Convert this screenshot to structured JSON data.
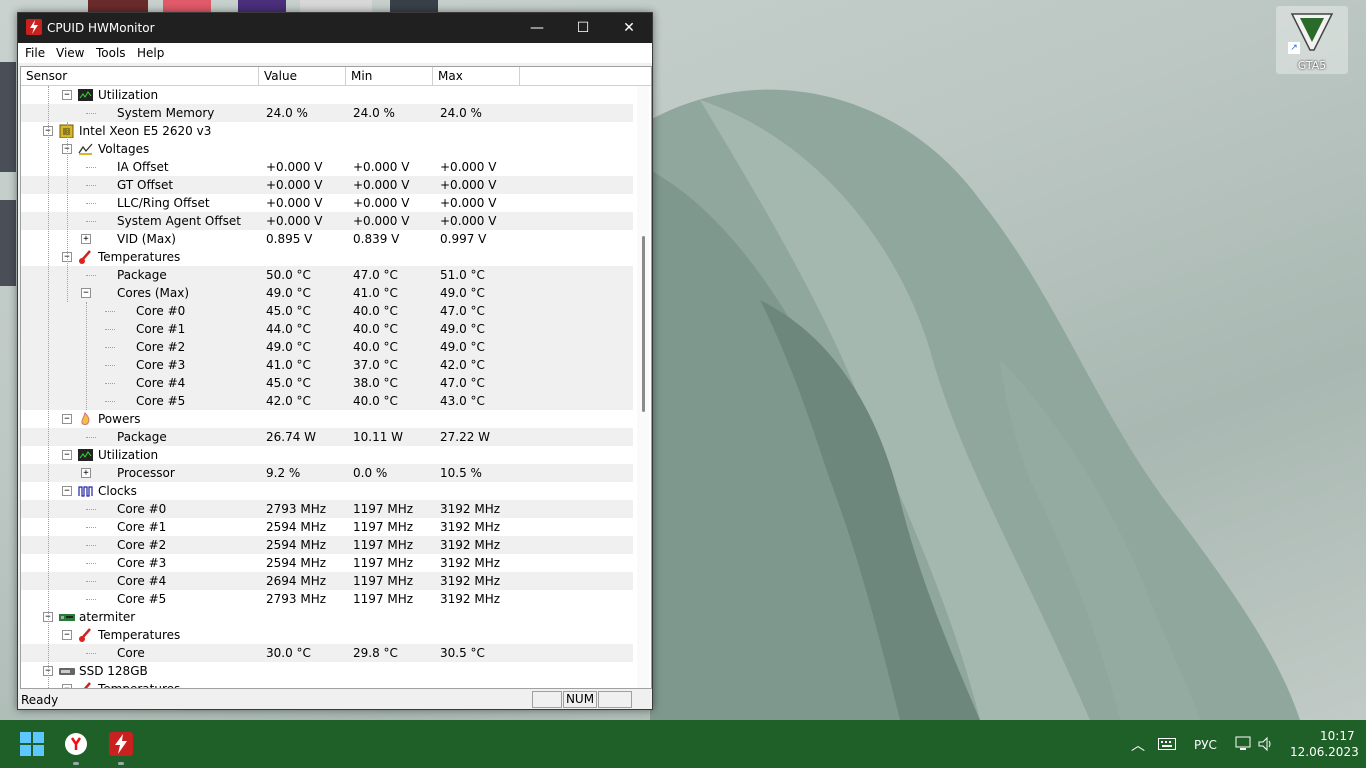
{
  "window": {
    "title": "CPUID HWMonitor",
    "controls": {
      "minimize": "—",
      "maximize": "☐",
      "close": "✕"
    }
  },
  "menu": [
    "File",
    "View",
    "Tools",
    "Help"
  ],
  "columns": [
    "Sensor",
    "Value",
    "Min",
    "Max"
  ],
  "rows": [
    {
      "label": "Utilization",
      "level": 1,
      "box": "−",
      "icon": "utilization-icon",
      "value": "",
      "min": "",
      "max": ""
    },
    {
      "label": "System Memory",
      "level": 2,
      "box": "",
      "icon": "",
      "value": "24.0 %",
      "min": "24.0 %",
      "max": "24.0 %"
    },
    {
      "label": "Intel Xeon E5 2620 v3",
      "level": 0,
      "box": "−",
      "icon": "cpu-chip-icon",
      "value": "",
      "min": "",
      "max": ""
    },
    {
      "label": "Voltages",
      "level": 1,
      "box": "−",
      "icon": "voltage-icon",
      "value": "",
      "min": "",
      "max": ""
    },
    {
      "label": "IA Offset",
      "level": 2,
      "box": "",
      "icon": "",
      "value": "+0.000 V",
      "min": "+0.000 V",
      "max": "+0.000 V"
    },
    {
      "label": "GT Offset",
      "level": 2,
      "box": "",
      "icon": "",
      "value": "+0.000 V",
      "min": "+0.000 V",
      "max": "+0.000 V"
    },
    {
      "label": "LLC/Ring Offset",
      "level": 2,
      "box": "",
      "icon": "",
      "value": "+0.000 V",
      "min": "+0.000 V",
      "max": "+0.000 V"
    },
    {
      "label": "System Agent Offset",
      "level": 2,
      "box": "",
      "icon": "",
      "value": "+0.000 V",
      "min": "+0.000 V",
      "max": "+0.000 V"
    },
    {
      "label": "VID (Max)",
      "level": 2,
      "box": "+",
      "icon": "",
      "value": "0.895 V",
      "min": "0.839 V",
      "max": "0.997 V"
    },
    {
      "label": "Temperatures",
      "level": 1,
      "box": "−",
      "icon": "thermometer-icon",
      "value": "",
      "min": "",
      "max": ""
    },
    {
      "label": "Package",
      "level": 2,
      "box": "",
      "icon": "",
      "value": "50.0 °C",
      "min": "47.0 °C",
      "max": "51.0 °C"
    },
    {
      "label": "Cores (Max)",
      "level": 2,
      "box": "−",
      "icon": "",
      "value": "49.0 °C",
      "min": "41.0 °C",
      "max": "49.0 °C"
    },
    {
      "label": "Core #0",
      "level": 3,
      "box": "",
      "icon": "",
      "value": "45.0 °C",
      "min": "40.0 °C",
      "max": "47.0 °C"
    },
    {
      "label": "Core #1",
      "level": 3,
      "box": "",
      "icon": "",
      "value": "44.0 °C",
      "min": "40.0 °C",
      "max": "49.0 °C"
    },
    {
      "label": "Core #2",
      "level": 3,
      "box": "",
      "icon": "",
      "value": "49.0 °C",
      "min": "40.0 °C",
      "max": "49.0 °C"
    },
    {
      "label": "Core #3",
      "level": 3,
      "box": "",
      "icon": "",
      "value": "41.0 °C",
      "min": "37.0 °C",
      "max": "42.0 °C"
    },
    {
      "label": "Core #4",
      "level": 3,
      "box": "",
      "icon": "",
      "value": "45.0 °C",
      "min": "38.0 °C",
      "max": "47.0 °C"
    },
    {
      "label": "Core #5",
      "level": 3,
      "box": "",
      "icon": "",
      "value": "42.0 °C",
      "min": "40.0 °C",
      "max": "43.0 °C"
    },
    {
      "label": "Powers",
      "level": 1,
      "box": "−",
      "icon": "power-flame-icon",
      "value": "",
      "min": "",
      "max": ""
    },
    {
      "label": "Package",
      "level": 2,
      "box": "",
      "icon": "",
      "value": "26.74 W",
      "min": "10.11 W",
      "max": "27.22 W"
    },
    {
      "label": "Utilization",
      "level": 1,
      "box": "−",
      "icon": "utilization-icon",
      "value": "",
      "min": "",
      "max": ""
    },
    {
      "label": "Processor",
      "level": 2,
      "box": "+",
      "icon": "",
      "value": "9.2 %",
      "min": "0.0 %",
      "max": "10.5 %"
    },
    {
      "label": "Clocks",
      "level": 1,
      "box": "−",
      "icon": "clock-wave-icon",
      "value": "",
      "min": "",
      "max": ""
    },
    {
      "label": "Core #0",
      "level": 2,
      "box": "",
      "icon": "",
      "value": "2793 MHz",
      "min": "1197 MHz",
      "max": "3192 MHz"
    },
    {
      "label": "Core #1",
      "level": 2,
      "box": "",
      "icon": "",
      "value": "2594 MHz",
      "min": "1197 MHz",
      "max": "3192 MHz"
    },
    {
      "label": "Core #2",
      "level": 2,
      "box": "",
      "icon": "",
      "value": "2594 MHz",
      "min": "1197 MHz",
      "max": "3192 MHz"
    },
    {
      "label": "Core #3",
      "level": 2,
      "box": "",
      "icon": "",
      "value": "2594 MHz",
      "min": "1197 MHz",
      "max": "3192 MHz"
    },
    {
      "label": "Core #4",
      "level": 2,
      "box": "",
      "icon": "",
      "value": "2694 MHz",
      "min": "1197 MHz",
      "max": "3192 MHz"
    },
    {
      "label": "Core #5",
      "level": 2,
      "box": "",
      "icon": "",
      "value": "2793 MHz",
      "min": "1197 MHz",
      "max": "3192 MHz"
    },
    {
      "label": "atermiter",
      "level": 0,
      "box": "−",
      "icon": "motherboard-icon",
      "value": "",
      "min": "",
      "max": ""
    },
    {
      "label": "Temperatures",
      "level": 1,
      "box": "−",
      "icon": "thermometer-icon",
      "value": "",
      "min": "",
      "max": ""
    },
    {
      "label": "Core",
      "level": 2,
      "box": "",
      "icon": "",
      "value": "30.0 °C",
      "min": "29.8 °C",
      "max": "30.5 °C"
    },
    {
      "label": "SSD 128GB",
      "level": 0,
      "box": "−",
      "icon": "drive-icon",
      "value": "",
      "min": "",
      "max": ""
    },
    {
      "label": "Temperatures",
      "level": 1,
      "box": "−",
      "icon": "thermometer-icon",
      "value": "",
      "min": "",
      "max": ""
    }
  ],
  "status": {
    "text": "Ready",
    "num": "NUM"
  },
  "desktop": {
    "icon_label": "GTA5"
  },
  "taskbar": {
    "apps": [
      "windows-start-icon",
      "yandex-browser-icon",
      "hwmonitor-icon"
    ],
    "language": "РУС",
    "time": "10:17",
    "date": "12.06.2023"
  },
  "colors": {
    "titlebar": "#202020",
    "taskbar": "#1f5f28",
    "app_red": "#c92020"
  }
}
